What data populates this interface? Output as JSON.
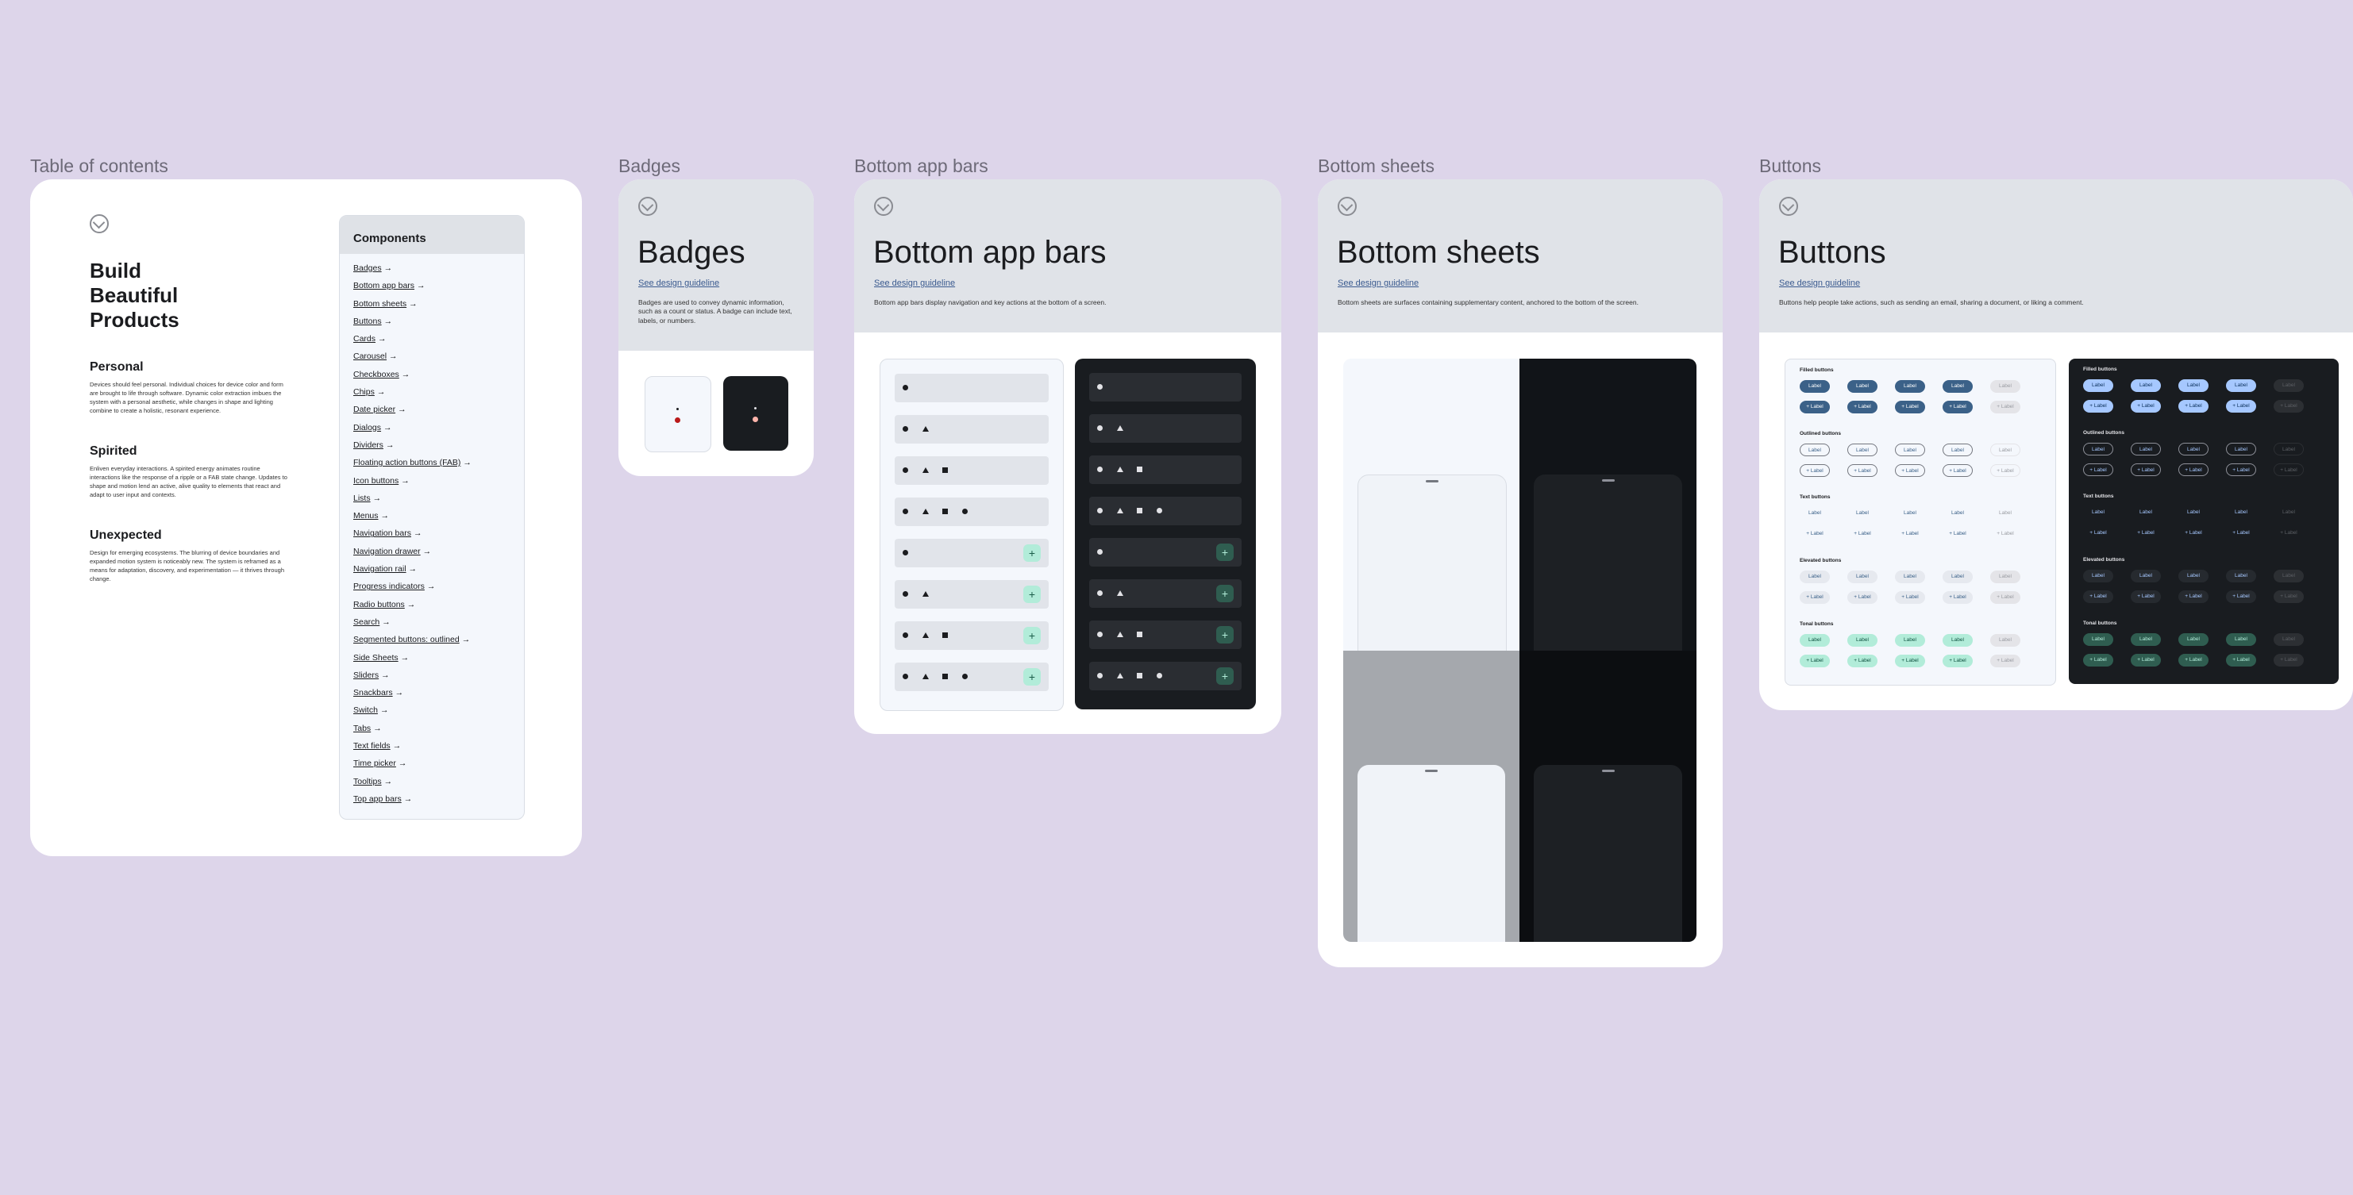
{
  "frame_titles": {
    "toc": "Table of contents",
    "badges": "Badges",
    "bottom_app_bars": "Bottom app bars",
    "bottom_sheets": "Bottom sheets",
    "buttons": "Buttons"
  },
  "toc": {
    "heading": "Build Beautiful Products",
    "sections": [
      {
        "title": "Personal",
        "text": "Devices should feel personal. Individual choices for device color and form are brought to life through software. Dynamic color extraction imbues the system with a personal aesthetic, while changes in shape and lighting combine to create a holistic, resonant experience."
      },
      {
        "title": "Spirited",
        "text": "Enliven everyday interactions. A spirited energy animates routine interactions like the response of a ripple or a FAB state change. Updates to shape and motion lend an active, alive quality to elements that react and adapt to user input and contexts."
      },
      {
        "title": "Unexpected",
        "text": "Design for emerging ecosystems. The blurring of device boundaries and expanded motion system is noticeably new. The system is reframed as a means for adaptation, discovery, and experimentation — it thrives through change."
      }
    ],
    "components_title": "Components",
    "components": [
      "Badges",
      "Bottom app bars",
      "Bottom sheets",
      "Buttons",
      "Cards",
      "Carousel",
      "Checkboxes",
      "Chips",
      "Date picker",
      "Dialogs",
      "Dividers",
      "Floating action buttons (FAB)",
      "Icon buttons",
      "Lists",
      "Menus",
      "Navigation bars",
      "Navigation drawer",
      "Navigation rail",
      "Progress indicators",
      "Radio buttons",
      "Search",
      "Segmented buttons: outlined",
      "Side Sheets",
      "Sliders",
      "Snackbars",
      "Switch",
      "Tabs",
      "Text fields",
      "Time picker",
      "Tooltips",
      "Top app bars"
    ],
    "arrow": "→"
  },
  "badges": {
    "title": "Badges",
    "link": "See design guideline",
    "description": "Badges are used to convey dynamic information, such as a count or status. A badge can include text, labels, or numbers."
  },
  "bottom_app_bars": {
    "title": "Bottom app bars",
    "link": "See design guideline",
    "description": "Bottom app bars display navigation and key actions at the bottom of a screen.",
    "fab_icon": "+"
  },
  "bottom_sheets": {
    "title": "Bottom sheets",
    "link": "See design guideline",
    "description": "Bottom sheets are surfaces containing supplementary content, anchored to the bottom of the screen."
  },
  "buttons": {
    "title": "Buttons",
    "link": "See design guideline",
    "description": "Buttons help people take actions, such as sending an email, sharing a document, or liking a comment.",
    "groups": [
      "Filled buttons",
      "Outlined buttons",
      "Text buttons",
      "Elevated buttons",
      "Tonal buttons"
    ],
    "label": "Label",
    "plus_label": "+ Label"
  },
  "colors": {
    "background": "#ddd5ea",
    "header": "#e0e3e8",
    "dark_surface": "#191c20",
    "filled_light": "#3b6188",
    "filled_dark": "#a6c8ff",
    "tonal_light": "#b2ecd9",
    "tonal_dark": "#2f5d50",
    "badge_red": "#ba1a1a"
  }
}
